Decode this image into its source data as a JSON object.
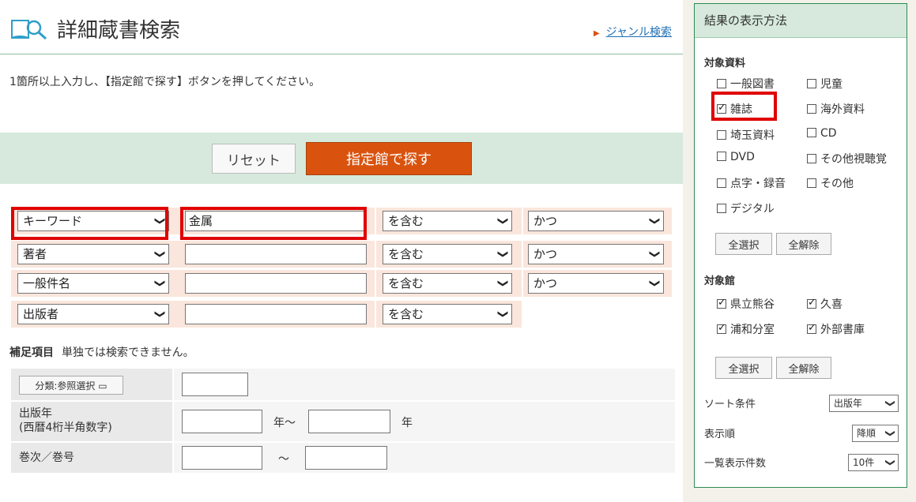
{
  "header": {
    "title": "詳細蔵書検索",
    "genre_link": "ジャンル検索",
    "book_icon": "open-book-search-icon"
  },
  "instruction": "1箇所以上入力し、【指定館で探す】ボタンを押してください。",
  "actions": {
    "reset": "リセット",
    "search": "指定館で探す"
  },
  "criteria": [
    {
      "field": "キーワード",
      "value": "金属",
      "match": "を含む",
      "op": "かつ"
    },
    {
      "field": "著者",
      "value": "",
      "match": "を含む",
      "op": "かつ"
    },
    {
      "field": "一般件名",
      "value": "",
      "match": "を含む",
      "op": "かつ"
    },
    {
      "field": "出版者",
      "value": "",
      "match": "を含む"
    }
  ],
  "supplement": {
    "title": "補足項目",
    "note": "単独では検索できません。",
    "class_button": "分類:参照選択",
    "pub_year_label_1": "出版年",
    "pub_year_label_2": "(西暦4桁半角数字)",
    "year_from_unit": "年～",
    "year_to_unit": "年",
    "volume_label": "巻次／巻号",
    "volume_sep": "～"
  },
  "sidebar": {
    "title": "結果の表示方法",
    "materials_title": "対象資料",
    "materials": [
      {
        "label": "一般図書",
        "checked": false
      },
      {
        "label": "児童",
        "checked": false
      },
      {
        "label": "雑誌",
        "checked": true
      },
      {
        "label": "海外資料",
        "checked": false
      },
      {
        "label": "埼玉資料",
        "checked": false
      },
      {
        "label": "CD",
        "checked": false
      },
      {
        "label": "DVD",
        "checked": false
      },
      {
        "label": "その他視聴覚",
        "checked": false
      },
      {
        "label": "点字・録音",
        "checked": false
      },
      {
        "label": "その他",
        "checked": false
      },
      {
        "label": "デジタル",
        "checked": false
      }
    ],
    "select_all": "全選択",
    "deselect_all": "全解除",
    "libraries_title": "対象館",
    "libraries": [
      {
        "label": "県立熊谷",
        "checked": true
      },
      {
        "label": "久喜",
        "checked": true
      },
      {
        "label": "浦和分室",
        "checked": true
      },
      {
        "label": "外部書庫",
        "checked": true
      }
    ],
    "sort_label": "ソート条件",
    "sort_value": "出版年",
    "order_label": "表示順",
    "order_value": "降順",
    "count_label": "一覧表示件数",
    "count_value": "10件"
  },
  "colors": {
    "accent": "#d9530f",
    "band": "#d6e9dc",
    "criteria_bg": "#fae6dc",
    "highlight": "#e00000",
    "link": "#1f6fb5"
  }
}
